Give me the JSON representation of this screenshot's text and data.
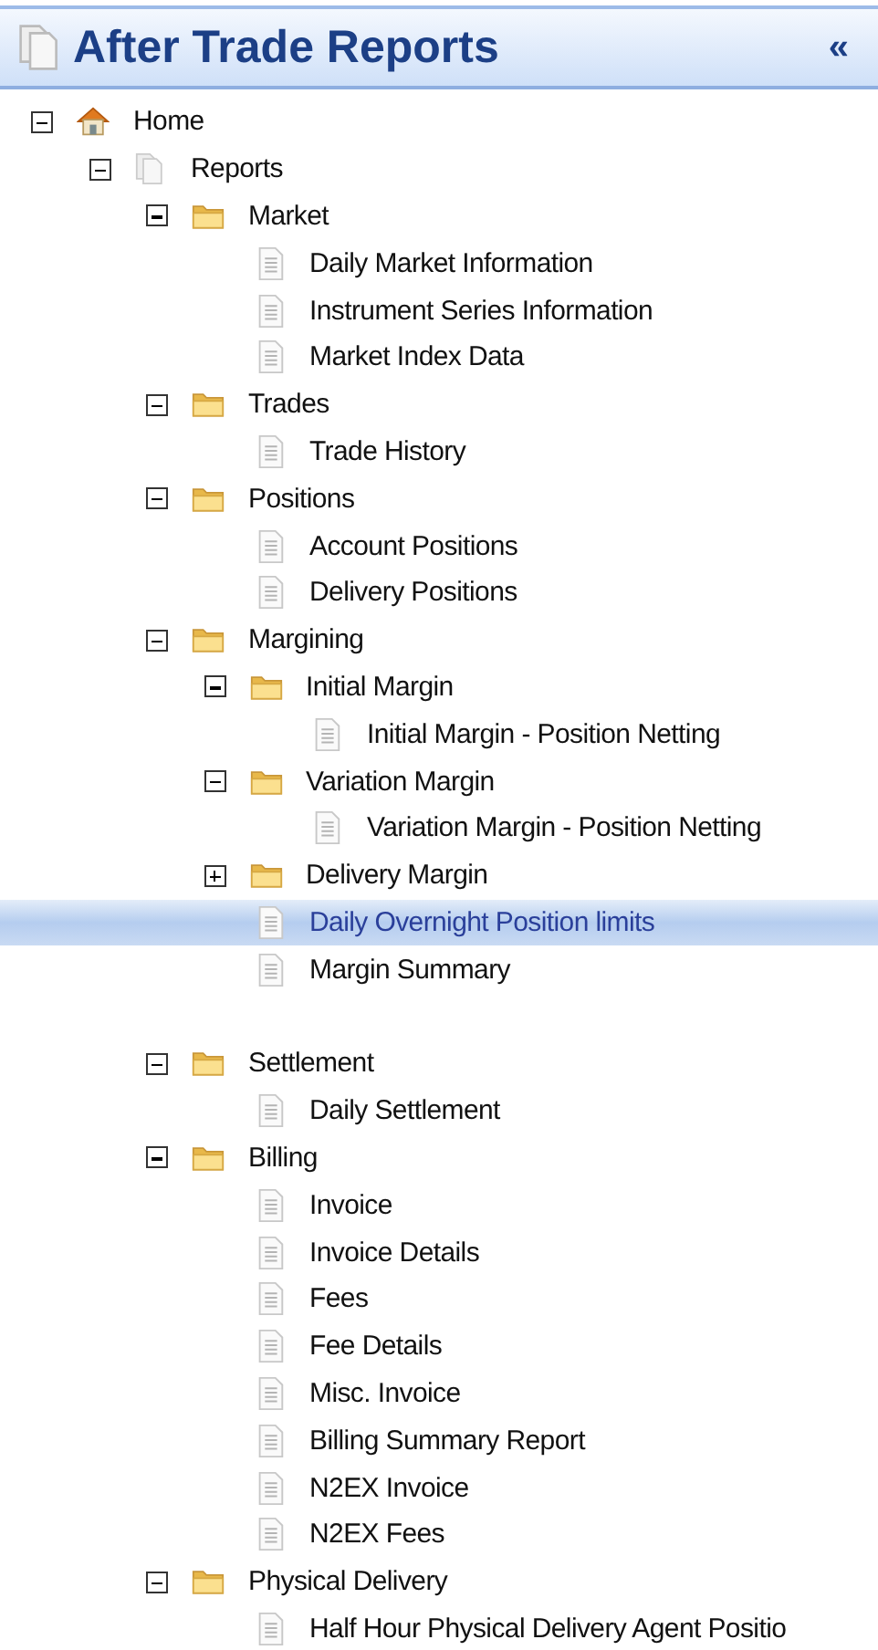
{
  "header": {
    "title": "After Trade Reports",
    "collapse": "«"
  },
  "tree": [
    {
      "kind": "home",
      "label": "Home",
      "expanded": true,
      "children": [
        {
          "kind": "reports",
          "label": "Reports",
          "expanded": true,
          "children": [
            {
              "kind": "folder",
              "label": "Market",
              "expanded": true,
              "children": [
                {
                  "kind": "doc",
                  "label": "Daily Market Information",
                  "selected": false
                },
                {
                  "kind": "doc",
                  "label": "Instrument Series Information",
                  "selected": false
                },
                {
                  "kind": "doc",
                  "label": "Market Index Data",
                  "selected": false
                }
              ]
            },
            {
              "kind": "folder",
              "label": "Trades",
              "expanded": true,
              "children": [
                {
                  "kind": "doc",
                  "label": "Trade History",
                  "selected": false
                }
              ]
            },
            {
              "kind": "folder",
              "label": "Positions",
              "expanded": true,
              "children": [
                {
                  "kind": "doc",
                  "label": "Account Positions",
                  "selected": false
                },
                {
                  "kind": "doc",
                  "label": "Delivery Positions",
                  "selected": false
                }
              ]
            },
            {
              "kind": "folder",
              "label": "Margining",
              "expanded": true,
              "children": [
                {
                  "kind": "folder",
                  "label": "Initial Margin",
                  "expanded": true,
                  "children": [
                    {
                      "kind": "doc",
                      "label": "Initial Margin - Position Netting",
                      "selected": false
                    }
                  ]
                },
                {
                  "kind": "folder",
                  "label": "Variation Margin",
                  "expanded": true,
                  "children": [
                    {
                      "kind": "doc",
                      "label": "Variation Margin - Position Netting",
                      "selected": false
                    }
                  ]
                },
                {
                  "kind": "folder",
                  "label": "Delivery Margin",
                  "expanded": false
                },
                {
                  "kind": "doc",
                  "label": "Daily Overnight Position limits",
                  "selected": true
                },
                {
                  "kind": "doc",
                  "label": "Margin Summary",
                  "selected": false
                },
                {
                  "kind": "blank"
                }
              ]
            },
            {
              "kind": "folder",
              "label": "Settlement",
              "expanded": true,
              "children": [
                {
                  "kind": "doc",
                  "label": "Daily Settlement",
                  "selected": false
                }
              ]
            },
            {
              "kind": "folder",
              "label": "Billing",
              "expanded": true,
              "children": [
                {
                  "kind": "doc",
                  "label": "Invoice",
                  "selected": false
                },
                {
                  "kind": "doc",
                  "label": "Invoice Details",
                  "selected": false
                },
                {
                  "kind": "doc",
                  "label": "Fees",
                  "selected": false
                },
                {
                  "kind": "doc",
                  "label": "Fee Details",
                  "selected": false
                },
                {
                  "kind": "doc",
                  "label": "Misc. Invoice",
                  "selected": false
                },
                {
                  "kind": "doc",
                  "label": "Billing Summary Report",
                  "selected": false
                },
                {
                  "kind": "doc",
                  "label": "N2EX Invoice",
                  "selected": false
                },
                {
                  "kind": "doc",
                  "label": "N2EX Fees",
                  "selected": false
                }
              ]
            },
            {
              "kind": "folder",
              "label": "Physical Delivery",
              "expanded": true,
              "children": [
                {
                  "kind": "doc",
                  "label": "Half Hour Physical Delivery Agent Positio",
                  "selected": false
                }
              ]
            }
          ]
        }
      ]
    }
  ]
}
